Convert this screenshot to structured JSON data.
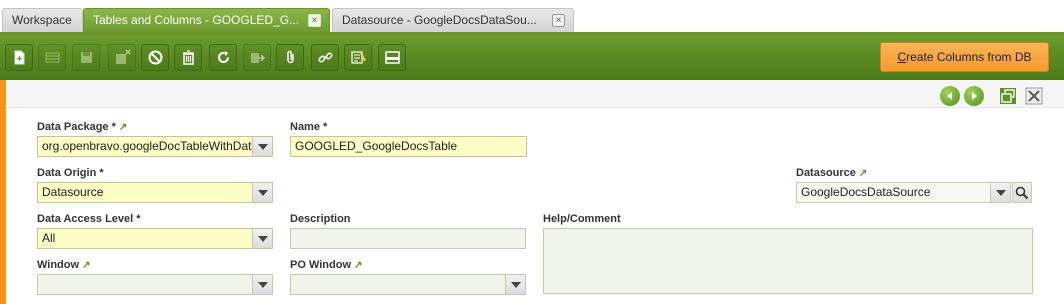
{
  "tabs": [
    {
      "label": "Workspace",
      "close": ""
    },
    {
      "label": "Tables and Columns - GOOGLED_G...",
      "close": "×"
    },
    {
      "label": "Datasource - GoogleDocsDataSou...",
      "close": "×"
    }
  ],
  "toolbar": {
    "create_columns_label_accel": "C",
    "create_columns_label_rest": "reate Columns from DB",
    "icons": [
      "new-document",
      "new-row",
      "save",
      "save-and-close",
      "undo",
      "delete",
      "refresh",
      "export",
      "attachment",
      "link",
      "tools",
      "grid-toggle"
    ]
  },
  "fields": {
    "data_package": {
      "label": "Data Package *",
      "link": "↗",
      "value": "org.openbravo.googleDocTableWithData"
    },
    "name": {
      "label": "Name *",
      "value": "GOOGLED_GoogleDocsTable"
    },
    "data_origin": {
      "label": "Data Origin *",
      "value": "Datasource"
    },
    "datasource": {
      "label": "Datasource",
      "link": "↗",
      "value": "GoogleDocsDataSource"
    },
    "data_access_level": {
      "label": "Data Access Level *",
      "value": "All"
    },
    "description": {
      "label": "Description",
      "value": ""
    },
    "help_comment": {
      "label": "Help/Comment",
      "value": ""
    },
    "window": {
      "label": "Window",
      "link": "↗",
      "value": ""
    },
    "po_window": {
      "label": "PO Window",
      "link": "↗",
      "value": ""
    }
  },
  "colors": {
    "accent_green": "#6a9328",
    "accent_orange": "#f39a2b",
    "required_bg": "#fdfdc6"
  }
}
